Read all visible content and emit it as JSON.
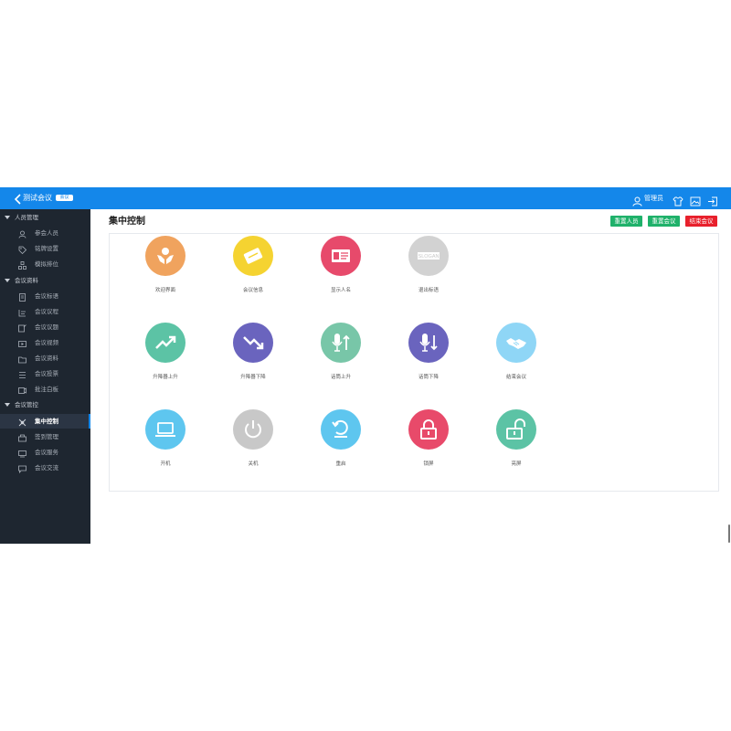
{
  "header": {
    "title": "测试会议",
    "badge": "会议",
    "user": "管理员",
    "bg_color": "#1487ea"
  },
  "sidebar": {
    "sections": [
      {
        "label": "人员管理",
        "items": [
          {
            "label": "参会人员",
            "icon": "person-icon"
          },
          {
            "label": "铭牌设置",
            "icon": "tag-icon"
          },
          {
            "label": "模拟排位",
            "icon": "seats-icon"
          }
        ]
      },
      {
        "label": "会议资料",
        "items": [
          {
            "label": "会议标语",
            "icon": "doc-icon"
          },
          {
            "label": "会议议程",
            "icon": "agenda-icon"
          },
          {
            "label": "会议议题",
            "icon": "topic-icon"
          },
          {
            "label": "会议视频",
            "icon": "video-icon"
          },
          {
            "label": "会议资料",
            "icon": "folder-icon"
          },
          {
            "label": "会议投票",
            "icon": "vote-icon"
          },
          {
            "label": "批注白板",
            "icon": "whiteboard-icon"
          }
        ]
      },
      {
        "label": "会议管控",
        "items": [
          {
            "label": "集中控制",
            "icon": "control-icon",
            "active": true
          },
          {
            "label": "签到管理",
            "icon": "signin-icon"
          },
          {
            "label": "会议服务",
            "icon": "service-icon"
          },
          {
            "label": "会议交流",
            "icon": "chat-icon"
          }
        ]
      }
    ]
  },
  "main": {
    "title": "集中控制",
    "buttons": [
      {
        "label": "重置人员",
        "color": "#1fb16a"
      },
      {
        "label": "重置会议",
        "color": "#1fb16a"
      },
      {
        "label": "结束会议",
        "color": "#e8202c"
      }
    ],
    "tiles": [
      {
        "label": "欢迎界面",
        "color": "#f0a35e",
        "icon": "welcome-hands-icon"
      },
      {
        "label": "会议信息",
        "color": "#f5d331",
        "icon": "card-icon"
      },
      {
        "label": "显示人名",
        "color": "#e74a6b",
        "icon": "nameplate-icon"
      },
      {
        "label": "退出标语",
        "color": "#d2d2d2",
        "icon": "slogan-icon",
        "icon_text": "SLOGAN"
      },
      {
        "label": "升降器上升",
        "color": "#5cc3a5",
        "icon": "trend-up-icon"
      },
      {
        "label": "升降器下降",
        "color": "#6a64be",
        "icon": "trend-down-icon"
      },
      {
        "label": "话筒上升",
        "color": "#78c6a8",
        "icon": "mic-up-icon"
      },
      {
        "label": "话筒下降",
        "color": "#6a64be",
        "icon": "mic-down-icon"
      },
      {
        "label": "结束会议",
        "color": "#8fd6f6",
        "icon": "handshake-icon"
      },
      {
        "label": "开机",
        "color": "#5ec6ef",
        "icon": "laptop-icon"
      },
      {
        "label": "关机",
        "color": "#c8c8c8",
        "icon": "power-icon"
      },
      {
        "label": "重启",
        "color": "#5ec6ef",
        "icon": "restart-icon"
      },
      {
        "label": "锁屏",
        "color": "#e84a6a",
        "icon": "lock-icon"
      },
      {
        "label": "亮屏",
        "color": "#5cc3a5",
        "icon": "unlock-icon"
      }
    ]
  }
}
